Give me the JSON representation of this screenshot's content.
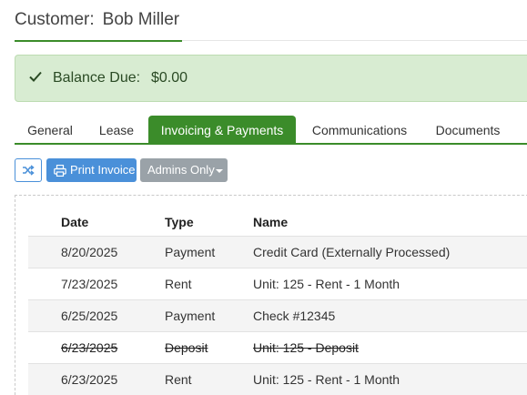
{
  "customer": {
    "label": "Customer:",
    "name": "Bob Miller"
  },
  "alert": {
    "label": "Balance Due:",
    "value": "$0.00",
    "icon": "check-icon"
  },
  "tabs": [
    {
      "label": "General",
      "active": false
    },
    {
      "label": "Lease",
      "active": false
    },
    {
      "label": "Invoicing & Payments",
      "active": true
    },
    {
      "label": "Communications",
      "active": false
    },
    {
      "label": "Documents",
      "active": false
    }
  ],
  "toolbar": {
    "shuffle_icon": "shuffle-icon",
    "print_icon": "printer-icon",
    "print_label": "Print Invoice",
    "admins_label": "Admins Only"
  },
  "table": {
    "headers": {
      "date": "Date",
      "type": "Type",
      "name": "Name"
    },
    "rows": [
      {
        "date": "8/20/2025",
        "type": "Payment",
        "name": "Credit Card (Externally Processed)",
        "void": false
      },
      {
        "date": "7/23/2025",
        "type": "Rent",
        "name": "Unit: 125 - Rent - 1 Month",
        "void": false
      },
      {
        "date": "6/25/2025",
        "type": "Payment",
        "name": "Check #12345",
        "void": false
      },
      {
        "date": "6/23/2025",
        "type": "Deposit",
        "name": "Unit: 125 - Deposit",
        "void": true
      },
      {
        "date": "6/23/2025",
        "type": "Rent",
        "name": "Unit: 125 - Rent - 1 Month",
        "void": false
      }
    ]
  },
  "colors": {
    "accent": "#3b8c2a",
    "primary": "#4a90d9",
    "alert_bg": "#d8ecd2",
    "muted_button": "#9aa2a8"
  }
}
